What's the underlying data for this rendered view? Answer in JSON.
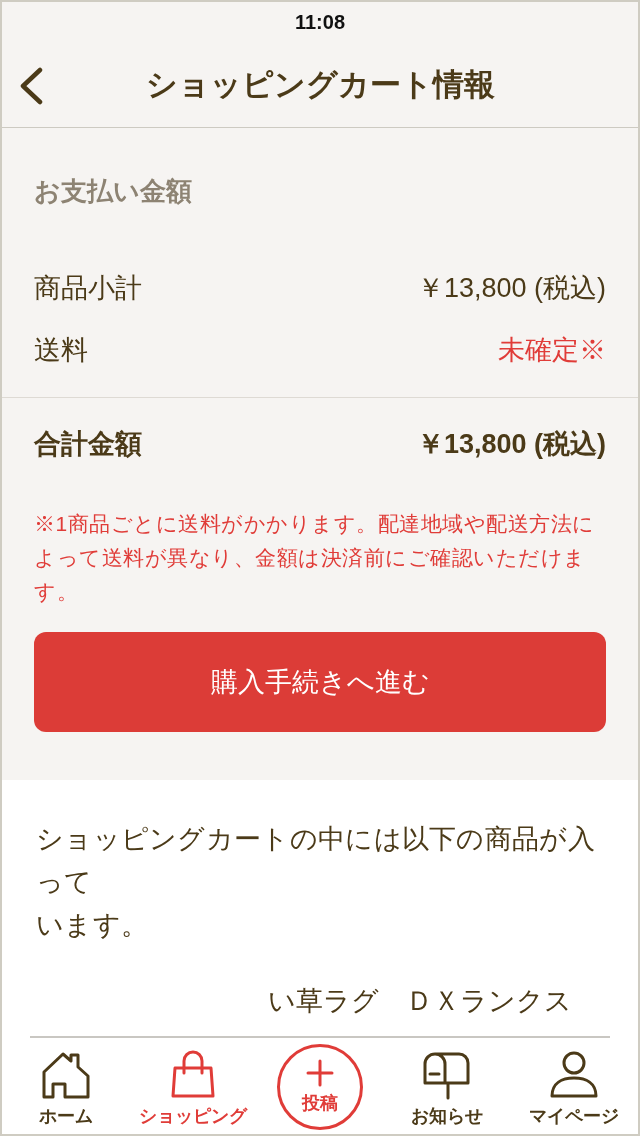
{
  "status_bar": {
    "time": "11:08"
  },
  "nav_bar": {
    "title": "ショッピングカート情報"
  },
  "payment": {
    "heading": "お支払い金額",
    "rows": [
      {
        "label": "商品小計",
        "value": "￥13,800 (税込)",
        "kind": "normal"
      },
      {
        "label": "送料",
        "value": "未確定※",
        "kind": "pending"
      }
    ],
    "total": {
      "label": "合計金額",
      "value": "￥13,800 (税込)"
    },
    "note": "※1商品ごとに送料がかかります。配達地域や配送方法によって送料が異なり、金額は決済前にご確認いただけます。",
    "checkout_button": "購入手続きへ進む"
  },
  "cart": {
    "message_lines": [
      "ショッピングカートの中には以下の商品が入って",
      "います。"
    ],
    "items": [
      {
        "name": "い草ラグ　ＤＸランクス"
      }
    ]
  },
  "tab_bar": {
    "tabs": [
      {
        "label": "ホーム",
        "kind": "tab",
        "selected": false
      },
      {
        "label": "ショッピング",
        "kind": "tab",
        "selected": true
      },
      {
        "label": "投稿",
        "kind": "action",
        "selected": false
      },
      {
        "label": "お知らせ",
        "kind": "tab",
        "selected": false
      },
      {
        "label": "マイページ",
        "kind": "tab",
        "selected": false
      }
    ]
  }
}
